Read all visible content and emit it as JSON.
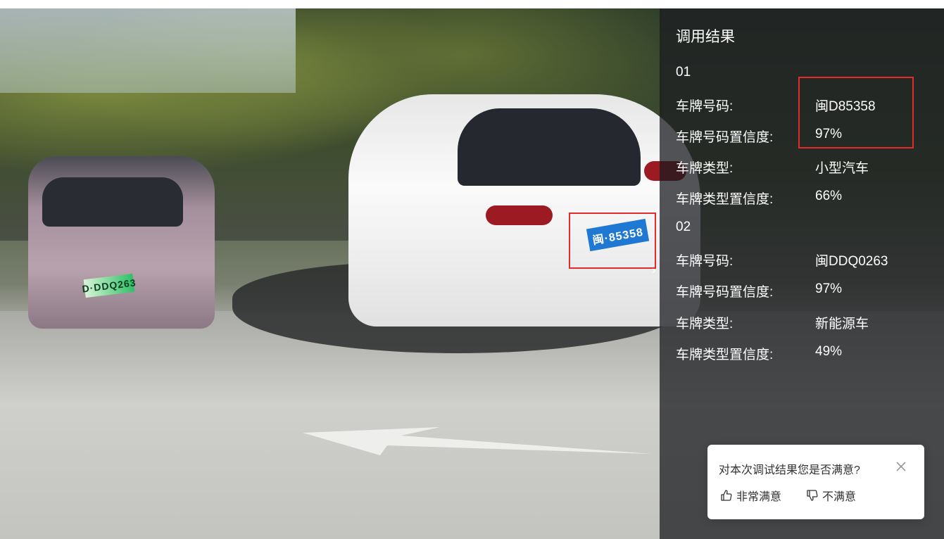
{
  "panel": {
    "title": "调用结果",
    "results": [
      {
        "index": "01",
        "plate_number_label": "车牌号码:",
        "plate_number": "闽D85358",
        "plate_confidence_label": "车牌号码置信度:",
        "plate_confidence": "97%",
        "plate_type_label": "车牌类型:",
        "plate_type": "小型汽车",
        "type_confidence_label": "车牌类型置信度:",
        "type_confidence": "66%"
      },
      {
        "index": "02",
        "plate_number_label": "车牌号码:",
        "plate_number": "闽DDQ0263",
        "plate_confidence_label": "车牌号码置信度:",
        "plate_confidence": "97%",
        "plate_type_label": "车牌类型:",
        "plate_type": "新能源车",
        "type_confidence_label": "车牌类型置信度:",
        "type_confidence": "49%"
      }
    ]
  },
  "scene": {
    "green_plate_text": "D·DDQ263",
    "blue_plate_text": "闽·85358"
  },
  "feedback": {
    "question": "对本次调试结果您是否满意?",
    "satisfied_label": "非常满意",
    "unsatisfied_label": "不满意"
  },
  "colors": {
    "highlight_box": "#e32b2b",
    "panel_bg": "rgba(24,26,30,0.74)",
    "panel_text": "#ffffff"
  }
}
